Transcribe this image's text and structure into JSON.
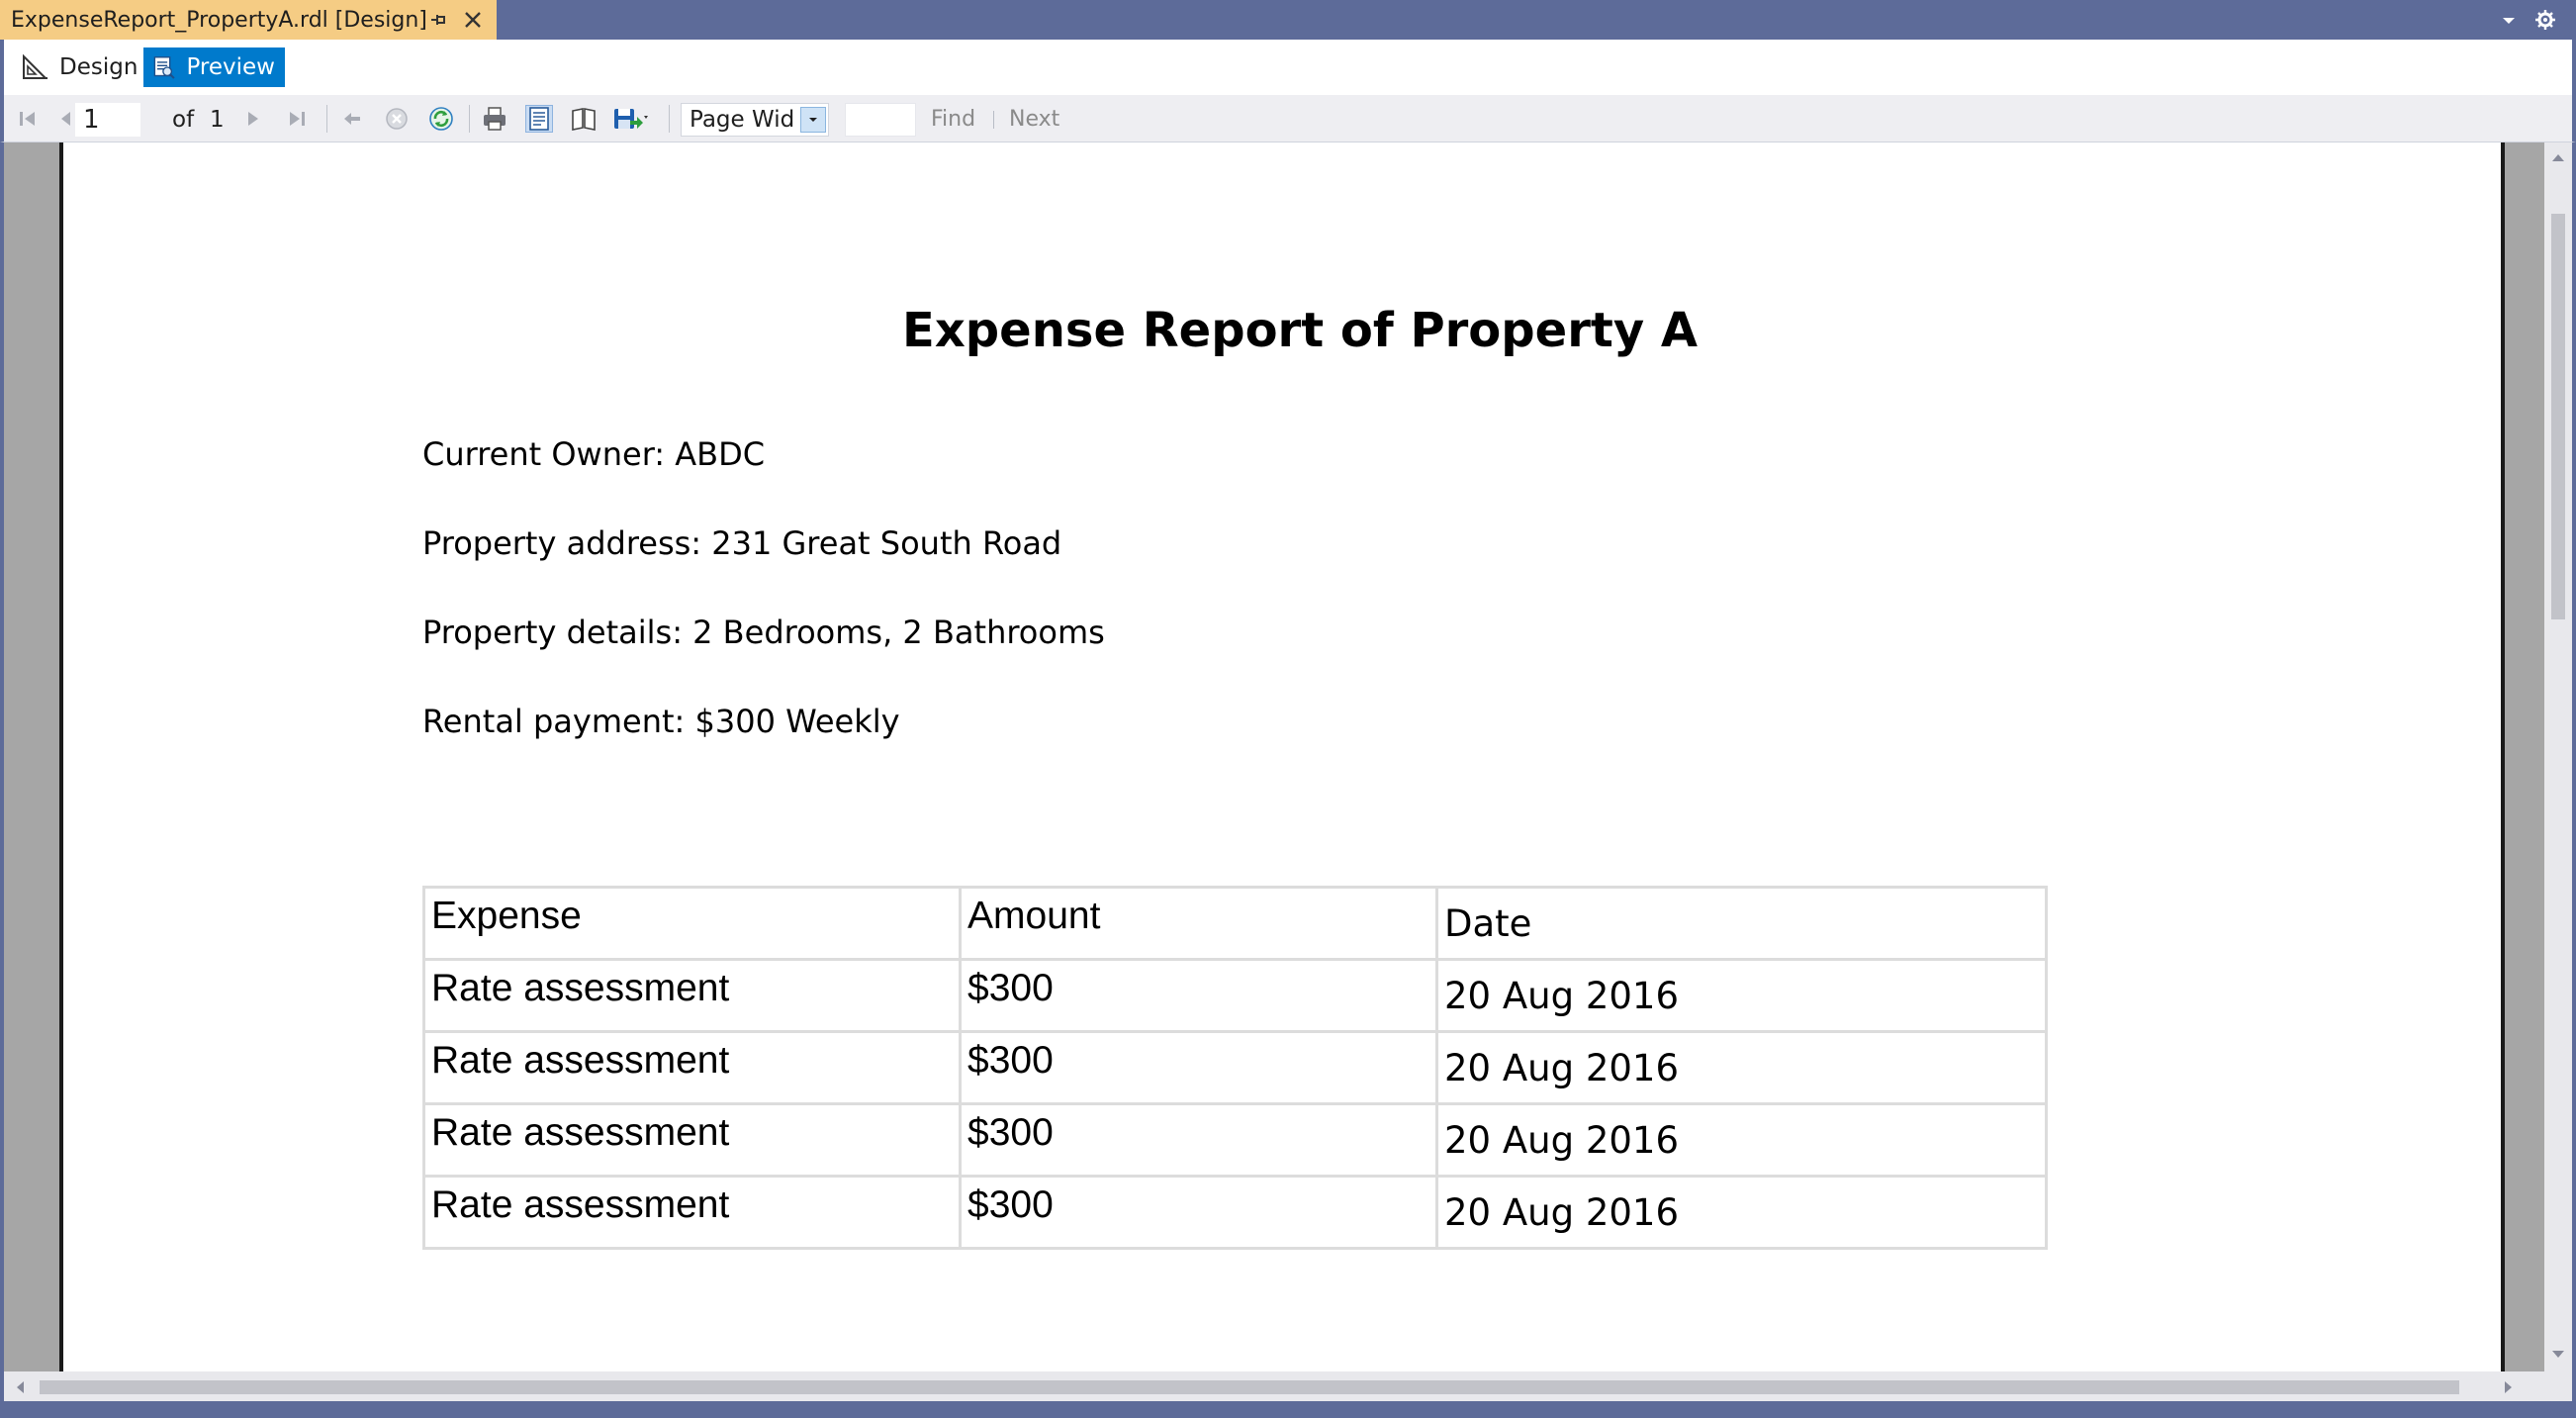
{
  "document_tab": {
    "title": "ExpenseReport_PropertyA.rdl [Design]"
  },
  "mode_bar": {
    "design_label": "Design",
    "preview_label": "Preview",
    "active": "Preview"
  },
  "toolbar": {
    "current_page": "1",
    "of_label": "of",
    "total_pages": "1",
    "zoom": "Page Wid",
    "find_label": "Find",
    "next_label": "Next"
  },
  "report": {
    "title": "Expense Report of Property A",
    "owner": "Current Owner: ABDC",
    "address": "Property address: 231 Great South Road",
    "details": "Property details: 2 Bedrooms, 2 Bathrooms",
    "rental": "Rental payment: $300 Weekly",
    "table": {
      "headers": [
        "Expense",
        "Amount",
        "Date"
      ],
      "rows": [
        [
          "Rate assessment",
          "$300",
          "20 Aug 2016"
        ],
        [
          "Rate assessment",
          "$300",
          "20 Aug 2016"
        ],
        [
          "Rate assessment",
          "$300",
          "20 Aug 2016"
        ],
        [
          "Rate assessment",
          "$300",
          "20 Aug 2016"
        ]
      ]
    }
  },
  "colors": {
    "chrome": "#5d6b99",
    "active_tab": "#f5cc84",
    "accent": "#007acc"
  }
}
